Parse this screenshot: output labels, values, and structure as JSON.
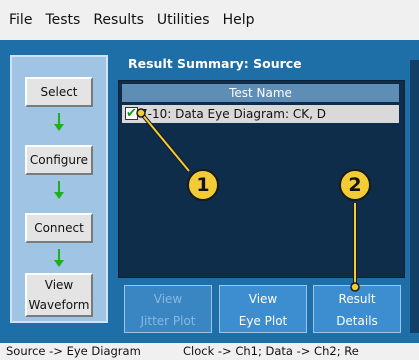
{
  "menu": [
    "File",
    "Tests",
    "Results",
    "Utilities",
    "Help"
  ],
  "workflow": {
    "select": "Select",
    "configure": "Configure",
    "connect": "Connect",
    "view_line1": "View",
    "view_line2": "Waveform"
  },
  "summary": {
    "title": "Result Summary: Source",
    "column_header": "Test Name",
    "rows": [
      {
        "check": "✔",
        "name": "7-10: Data Eye Diagram: CK, D"
      }
    ]
  },
  "buttons": {
    "jitter_line1": "View",
    "jitter_line2": "Jitter Plot",
    "eye_line1": "View",
    "eye_line2": "Eye Plot",
    "result_line1": "Result",
    "result_line2": "Details"
  },
  "status": {
    "left": "Source -> Eye Diagram",
    "right": "Clock -> Ch1; Data -> Ch2; Re"
  },
  "callouts": [
    "1",
    "2"
  ],
  "colors": {
    "background": "#1e6ea7",
    "accent_check": "#119a11",
    "callout_fill": "#f2cc37",
    "arrow_green": "#1cb01c"
  }
}
